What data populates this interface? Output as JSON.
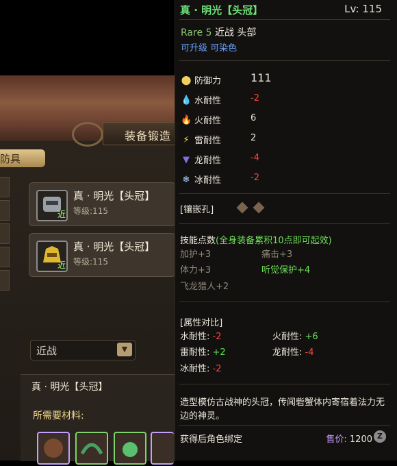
{
  "forge": {
    "title": "装备锻造",
    "gear_tab": "防具",
    "items": [
      {
        "name": "真 · 明光【头冠】",
        "level": "等级:115",
        "tag": "近"
      },
      {
        "name": "真 · 明光【头冠】",
        "level": "等级:115",
        "tag": "近"
      }
    ],
    "filter_value": "近战",
    "selected_name": "真 · 明光【头冠】",
    "materials_label": "所需要材料:"
  },
  "tooltip": {
    "title": "真 · 明光【头冠】",
    "level": "Lv: 115",
    "rarity": "Rare 5",
    "type": "近战",
    "slot": "头部",
    "flags": [
      "可升级",
      "可染色"
    ],
    "stats": [
      {
        "icon": "shield-icon",
        "label": "防御力",
        "value": "111",
        "tone": "wht"
      },
      {
        "icon": "water-icon",
        "label": "水耐性",
        "value": "-2",
        "tone": "neg"
      },
      {
        "icon": "fire-icon",
        "label": "火耐性",
        "value": "6",
        "tone": "wht"
      },
      {
        "icon": "thunder-icon",
        "label": "雷耐性",
        "value": "2",
        "tone": "wht"
      },
      {
        "icon": "dragon-icon",
        "label": "龙耐性",
        "value": "-4",
        "tone": "neg"
      },
      {
        "icon": "ice-icon",
        "label": "冰耐性",
        "value": "-2",
        "tone": "neg"
      }
    ],
    "socket_label": "[镶嵌孔]",
    "skill_head": "技能点数",
    "skill_note": "(全身装备累积10点即可起效)",
    "skills": [
      {
        "text": "加护+3",
        "active": false
      },
      {
        "text": "痛击+3",
        "active": false
      },
      {
        "text": "体力+3",
        "active": false
      },
      {
        "text": "听觉保护+4",
        "active": true
      },
      {
        "text": "飞龙猎人+2",
        "active": false
      }
    ],
    "compare_head": "[属性对比]",
    "compare": [
      {
        "label": "水耐性:",
        "value": "-2",
        "tone": "neg"
      },
      {
        "label": "火耐性:",
        "value": "+6",
        "tone": "pos"
      },
      {
        "label": "雷耐性:",
        "value": "+2",
        "tone": "pos"
      },
      {
        "label": "龙耐性:",
        "value": "-4",
        "tone": "neg"
      },
      {
        "label": "冰耐性:",
        "value": "-2",
        "tone": "neg"
      }
    ],
    "description": "造型模仿古战神的头冠，传闻砦蟹体内寄宿着法力无边的神灵。",
    "bind": "获得后角色绑定",
    "price_label": "售价:",
    "price_value": "1200",
    "currency": "Z"
  }
}
